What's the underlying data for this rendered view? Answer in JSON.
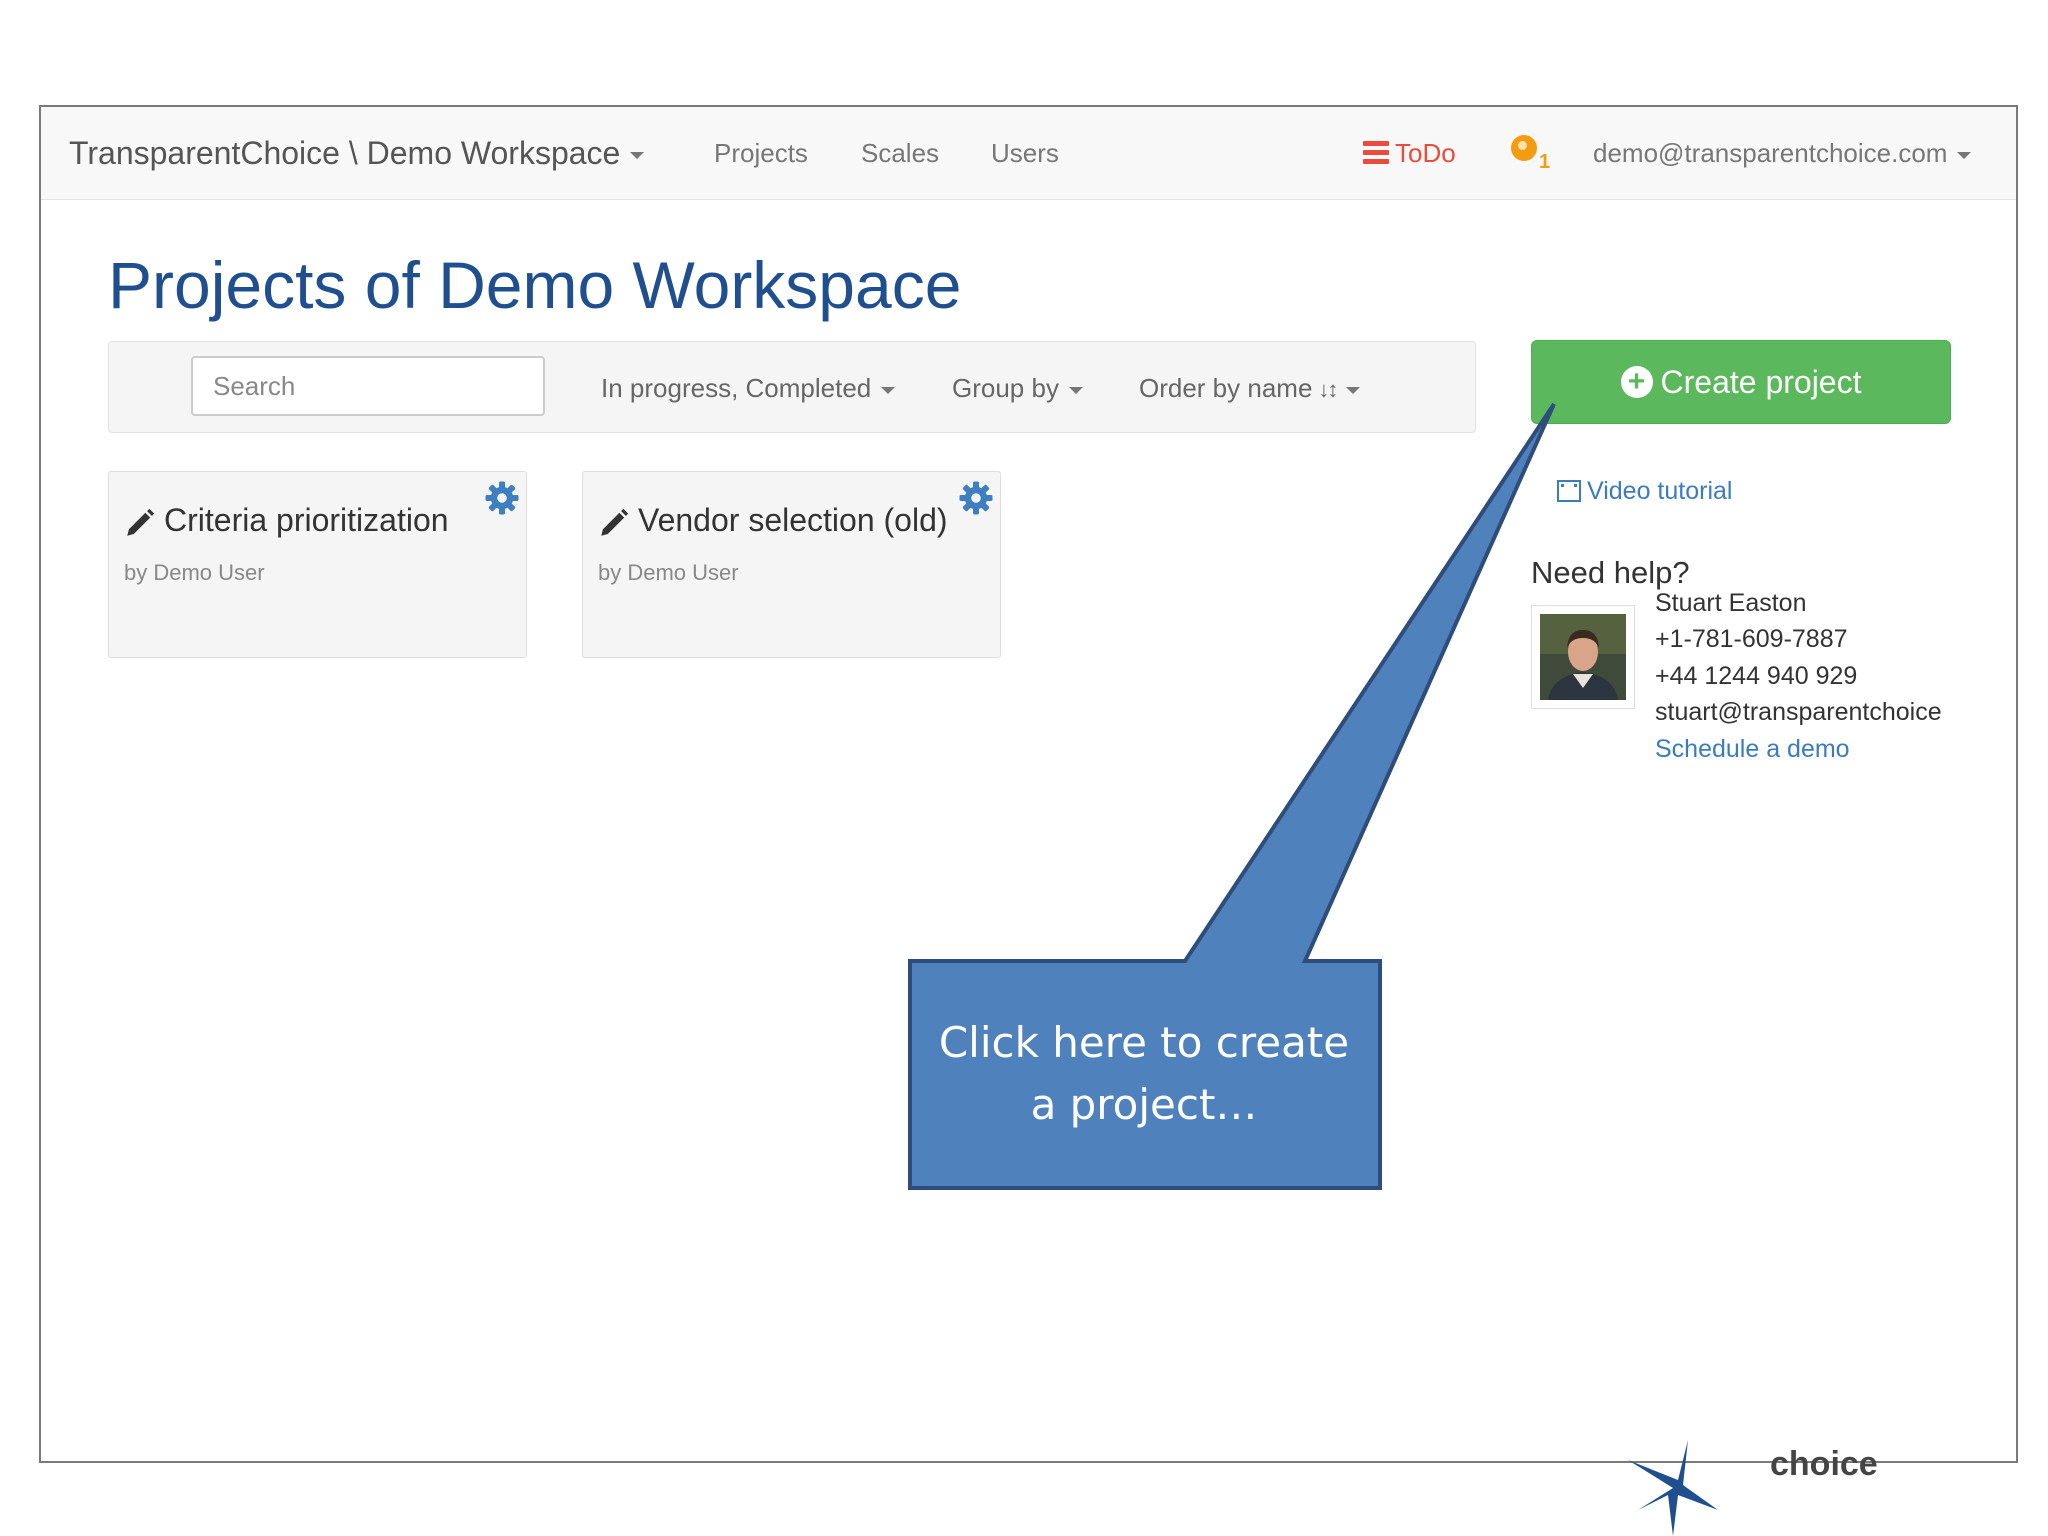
{
  "navbar": {
    "brand": "TransparentChoice \\ Demo Workspace",
    "links": {
      "projects": "Projects",
      "scales": "Scales",
      "users": "Users"
    },
    "todo": "ToDo",
    "notification_count": "1",
    "user_email": "demo@transparentchoice.com"
  },
  "page": {
    "title": "Projects of Demo Workspace"
  },
  "filters": {
    "search_placeholder": "Search",
    "status": "In progress, Completed",
    "group_by": "Group by",
    "order_by": "Order by name"
  },
  "projects": [
    {
      "title": "Criteria prioritization",
      "author": "by Demo User"
    },
    {
      "title": "Vendor selection (old)",
      "author": "by Demo User"
    }
  ],
  "sidebar": {
    "create_button": "Create project",
    "video_link": "Video tutorial",
    "help_heading": "Need help?",
    "contact": {
      "name": "Stuart Easton",
      "phone_us": "+1-781-609-7887",
      "phone_uk": "+44 1244 940 929",
      "email": "stuart@transparentchoice",
      "schedule_link": "Schedule a demo"
    }
  },
  "callout": {
    "line1": "Click here to create",
    "line2": "a project…"
  },
  "footer_logo_text": "choice",
  "colors": {
    "brand_blue": "#1f4f8f",
    "link_blue": "#3b7bbf",
    "create_green": "#5cb85c",
    "todo_red": "#e74c3c",
    "callout_fill": "#4f81bd",
    "callout_border": "#2e4d7b"
  },
  "icons": [
    "caret-down-icon",
    "list-icon",
    "globe-icon",
    "sort-alpha-icon",
    "pencil-icon",
    "gear-icon",
    "plus-circle-icon",
    "film-icon"
  ]
}
